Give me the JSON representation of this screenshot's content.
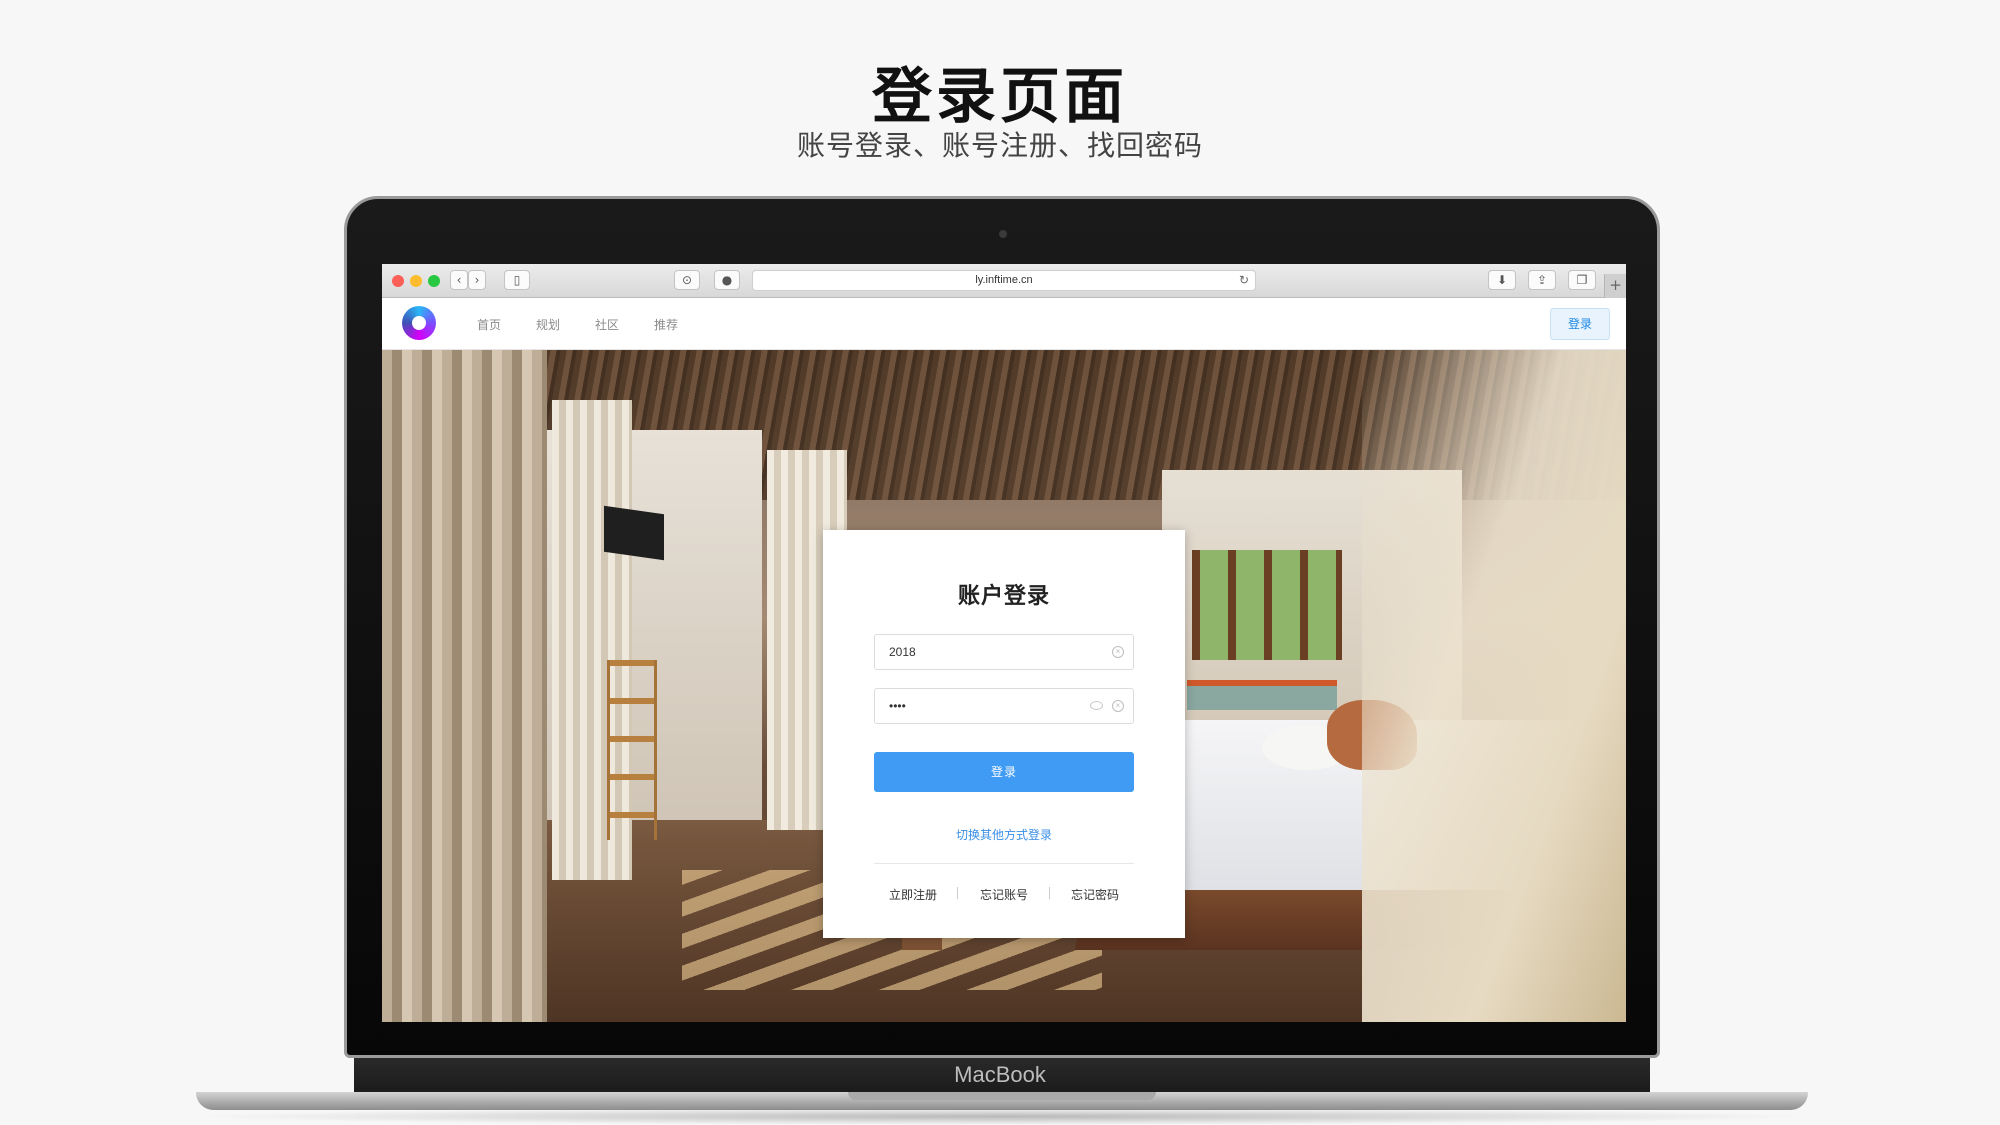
{
  "headline": "登录页面",
  "subline": "账号登录、账号注册、找回密码",
  "device_label": "MacBook",
  "browser": {
    "url": "ly.inftime.cn",
    "icons": [
      "back-icon",
      "forward-icon",
      "sidebar-icon",
      "reader-icon",
      "extension-icon",
      "reload-icon",
      "download-icon",
      "share-icon",
      "tabs-icon",
      "new-tab-icon"
    ]
  },
  "site_nav": {
    "links": [
      "首页",
      "规划",
      "社区",
      "推荐"
    ],
    "login_label": "登录"
  },
  "login_card": {
    "title": "账户登录",
    "username_value": "2018",
    "password_value": "••••",
    "submit_label": "登录",
    "switch_label": "切换其他方式登录",
    "footer_links": [
      "立即注册",
      "忘记账号",
      "忘记密码"
    ]
  },
  "colors": {
    "primary": "#3f9bf4",
    "link": "#3a8ee6",
    "nav_login_bg": "#e8f3fd"
  }
}
